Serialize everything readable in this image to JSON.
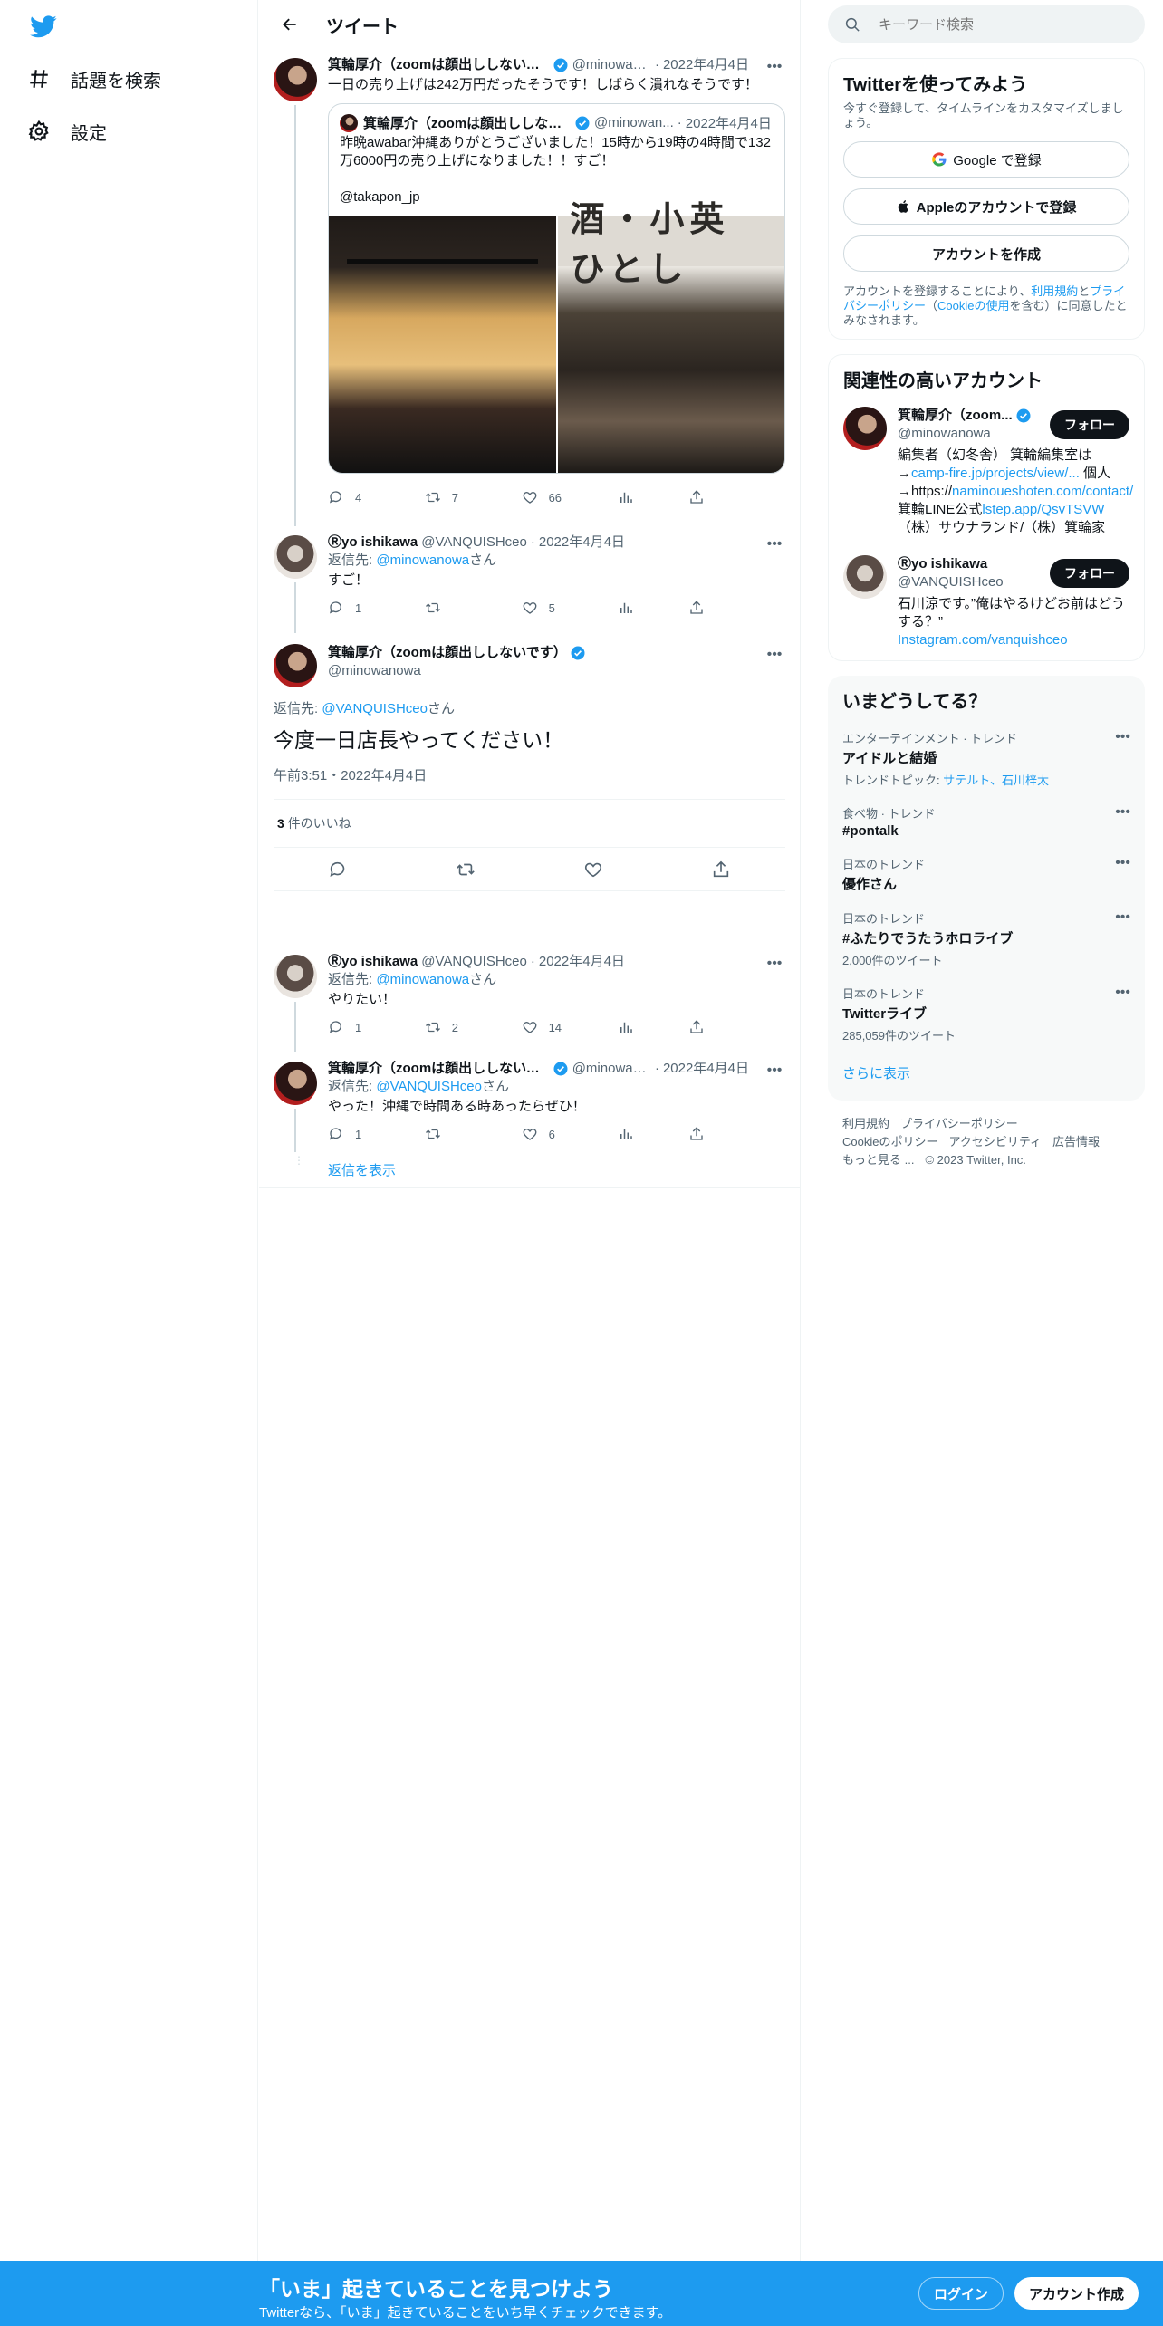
{
  "nav": {
    "explore": "話題を検索",
    "settings": "設定"
  },
  "header": {
    "title": "ツイート"
  },
  "thread": {
    "t1": {
      "name": "箕輪厚介（zoomは顔出ししないで...",
      "handle": "@minowan...",
      "date": "2022年4月4日",
      "text": "一日の売り上げは242万円だったそうです！しばらく潰れなそうです！",
      "quote": {
        "name": "箕輪厚介（zoomは顔出ししない...",
        "handle": "@minowan...",
        "date": "2022年4月4日",
        "text": "昨晩awabar沖縄ありがとうございました！15時から19時の4時間で132万6000円の売り上げになりました！！すご！\n\n@takapon_jp",
        "sign_text": "酒・小英 ひとし"
      },
      "replies": "4",
      "retweets": "7",
      "likes": "66"
    },
    "t2": {
      "name": "Ⓡyo ishikawa",
      "handle": "@VANQUISHceo",
      "date": "2022年4月4日",
      "reply_prefix": "返信先: ",
      "reply_to": "@minowanowa",
      "reply_suffix": "さん",
      "text": "すご！",
      "replies": "1",
      "retweets": "",
      "likes": "5"
    },
    "focus": {
      "name": "箕輪厚介（zoomは顔出ししないです）",
      "handle": "@minowanowa",
      "reply_prefix": "返信先: ",
      "reply_to": "@VANQUISHceo",
      "reply_suffix": "さん",
      "text": "今度一日店長やってください！",
      "timestamp": "午前3:51・2022年4月4日",
      "likes_count": "3",
      "likes_label": " 件のいいね"
    },
    "r1": {
      "name": "Ⓡyo ishikawa",
      "handle": "@VANQUISHceo",
      "date": "2022年4月4日",
      "reply_prefix": "返信先: ",
      "reply_to": "@minowanowa",
      "reply_suffix": "さん",
      "text": "やりたい！",
      "replies": "1",
      "retweets": "2",
      "likes": "14"
    },
    "r2": {
      "name": "箕輪厚介（zoomは顔出ししないで...",
      "handle": "@minowan...",
      "date": "2022年4月4日",
      "reply_prefix": "返信先: ",
      "reply_to": "@VANQUISHceo",
      "reply_suffix": "さん",
      "text": "やった！沖縄で時間ある時あったらぜひ！",
      "replies": "1",
      "retweets": "",
      "likes": "6"
    },
    "show_replies": "返信を表示"
  },
  "right": {
    "search_placeholder": "キーワード検索",
    "signup_card": {
      "title": "Twitterを使ってみよう",
      "subtitle": "今すぐ登録して、タイムラインをカスタマイズしましょう。",
      "google": "Google で登録",
      "apple": "Appleのアカウントで登録",
      "create": "アカウントを作成",
      "legal_1": "アカウントを登録することにより、",
      "legal_terms": "利用規約",
      "legal_2": "と",
      "legal_privacy": "プライバシーポリシー",
      "legal_3": "（",
      "legal_cookie": "Cookieの使用",
      "legal_4": "を含む）に同意したとみなされます。"
    },
    "related": {
      "title": "関連性の高いアカウント",
      "follow": "フォロー",
      "a1": {
        "name": "箕輪厚介（zoom...",
        "handle": "@minowanowa",
        "bio_1": "編集者（幻冬舎） 箕輪編集室は→",
        "bio_link1": "camp-fire.jp/projects/view/...",
        "bio_2": " 個人→https://",
        "bio_link2": "naminoueshoten.com/contact/",
        "bio_3": " 箕輪LINE公式",
        "bio_link3": "lstep.app/QsvTSVW",
        "bio_4": "（株）サウナランド/（株）箕輪家"
      },
      "a2": {
        "name": "Ⓡyo ishikawa",
        "handle": "@VANQUISHceo",
        "bio_1": "石川涼です。”俺はやるけどお前はどうする？”",
        "bio_link": "Instagram.com/vanquishceo"
      }
    },
    "trends": {
      "title": "いまどうしてる？",
      "items": [
        {
          "cat": "エンターテインメント · トレンド",
          "title": "アイドルと結婚",
          "count_prefix": "トレンドトピック: ",
          "count_links": "サテルト、石川梓太"
        },
        {
          "cat": "食べ物 · トレンド",
          "title": "#pontalk",
          "count": ""
        },
        {
          "cat": "日本のトレンド",
          "title": "優作さん",
          "count": ""
        },
        {
          "cat": "日本のトレンド",
          "title": "#ふたりでうたうホロライブ",
          "count": "2,000件のツイート"
        },
        {
          "cat": "日本のトレンド",
          "title": "Twitterライブ",
          "count": "285,059件のツイート"
        }
      ],
      "show_more": "さらに表示"
    },
    "footer": {
      "l1": "利用規約",
      "l2": "プライバシーポリシー",
      "l3": "Cookieのポリシー",
      "l4": "アクセシビリティ",
      "l5": "広告情報",
      "l6": "もっと見る ...",
      "l7": "© 2023 Twitter, Inc."
    }
  },
  "bottom": {
    "title": "「いま」起きていることを見つけよう",
    "subtitle": "Twitterなら、「いま」起きていることをいち早くチェックできます。",
    "login": "ログイン",
    "signup": "アカウント作成"
  },
  "colors": {
    "accent": "#1d9bf0",
    "text": "#0f1419",
    "muted": "#536471"
  }
}
